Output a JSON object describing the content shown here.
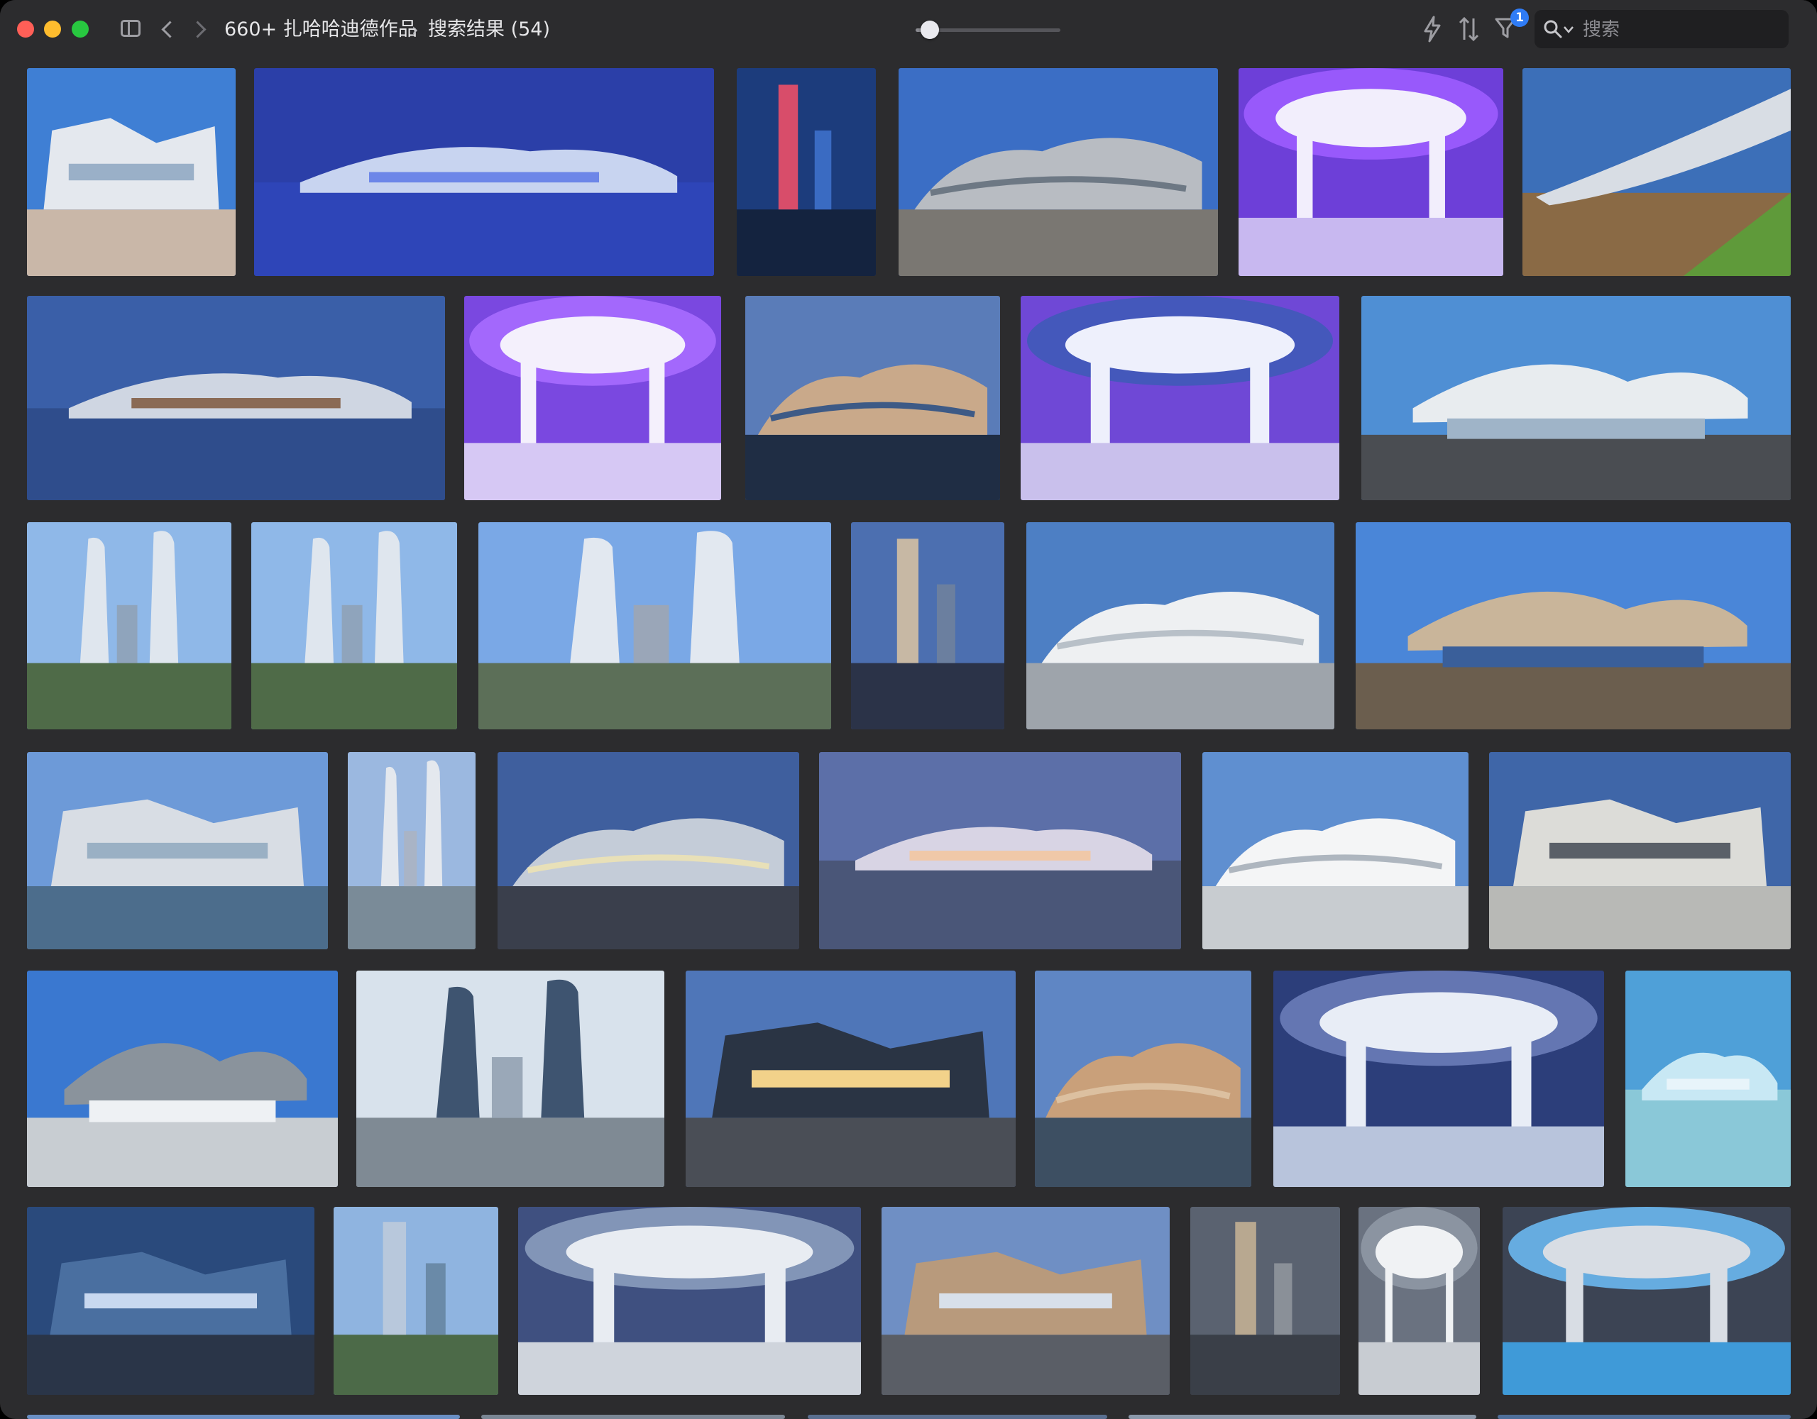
{
  "window": {
    "breadcrumb": [
      "660+ 扎哈哈迪德作品",
      "›",
      "搜索结果 (54)"
    ],
    "filter_badge": "1",
    "zoom_level": 0.1
  },
  "search": {
    "placeholder": "搜索",
    "value": ""
  },
  "colors": {
    "window_bg": "#2c2c2e",
    "accent": "#2f7cf6"
  },
  "icons": [
    "sidebar-toggle-icon",
    "back-icon",
    "forward-icon",
    "lightning-icon",
    "sort-icon",
    "filter-icon",
    "search-icon",
    "chevron-down-icon"
  ],
  "thumbnails": [
    {
      "name": "white-angular-building-day",
      "sky": "#3f7fd4",
      "ground": "#c9b7a8",
      "shape": "#e4e8ee",
      "accent": "#9ab0c8",
      "kind": "angular"
    },
    {
      "name": "night-snow-pavilion",
      "sky": "#2b3fa8",
      "ground": "#2e45b8",
      "shape": "#c8d4f0",
      "accent": "#6d86e8",
      "kind": "flat"
    },
    {
      "name": "ski-jump-tower-night",
      "sky": "#1c3c7c",
      "ground": "#14233f",
      "shape": "#d84d6a",
      "accent": "#3a6bc2",
      "kind": "tower"
    },
    {
      "name": "steel-concert-hall",
      "sky": "#3b6ec5",
      "ground": "#7a7772",
      "shape": "#b8bcc2",
      "accent": "#6d7884",
      "kind": "curvy"
    },
    {
      "name": "purple-lit-interior",
      "sky": "#6d3fd8",
      "ground": "#c8b8f0",
      "shape": "#f2eefc",
      "accent": "#9c5cff",
      "kind": "interior"
    },
    {
      "name": "bridge-pavilion-river",
      "sky": "#3c6fb8",
      "ground": "#8a6a45",
      "shape": "#d8dde4",
      "accent": "#5f9a3a",
      "kind": "bridge"
    },
    {
      "name": "science-center-dusk",
      "sky": "#3a5fa8",
      "ground": "#2f4d8c",
      "shape": "#cfd6e2",
      "accent": "#8a6a55",
      "kind": "flat"
    },
    {
      "name": "purple-gallery-columns",
      "sky": "#7a48e0",
      "ground": "#d6c8f4",
      "shape": "#f4f0fc",
      "accent": "#a76cff",
      "kind": "interior"
    },
    {
      "name": "curved-building-dusk-water",
      "sky": "#5a7cb8",
      "ground": "#1f2d44",
      "shape": "#c9a98a",
      "accent": "#3d5a86",
      "kind": "curvy"
    },
    {
      "name": "aviation-gallery-purple",
      "sky": "#6f48d6",
      "ground": "#c9c0ec",
      "shape": "#eef0fc",
      "accent": "#3f5ab8",
      "kind": "interior"
    },
    {
      "name": "white-canopy-station",
      "sky": "#4f8fd4",
      "ground": "#4a4d52",
      "shape": "#e8ecef",
      "accent": "#9fb4c8",
      "kind": "canopy"
    },
    {
      "name": "twin-towers-park-a",
      "sky": "#8fb8e8",
      "ground": "#4f6b48",
      "shape": "#dfe6ee",
      "accent": "#8fa4bc",
      "kind": "twin"
    },
    {
      "name": "twin-towers-park-b",
      "sky": "#8fb8e8",
      "ground": "#4f6b48",
      "shape": "#dfe6ee",
      "accent": "#8fa4bc",
      "kind": "twin"
    },
    {
      "name": "twin-towers-wide",
      "sky": "#7aa8e6",
      "ground": "#5c6f58",
      "shape": "#e2e8f0",
      "accent": "#9aa6b8",
      "kind": "twin"
    },
    {
      "name": "tall-tower-dusk",
      "sky": "#4c6fb0",
      "ground": "#2b3348",
      "shape": "#c7b8a4",
      "accent": "#6b7f9f",
      "kind": "tower"
    },
    {
      "name": "wave-building-blue-sky",
      "sky": "#4d7fc4",
      "ground": "#9ea4ab",
      "shape": "#eef0f2",
      "accent": "#b8c0c8",
      "kind": "curvy"
    },
    {
      "name": "aquatics-centre-waterfront",
      "sky": "#4a86d8",
      "ground": "#6b5e4e",
      "shape": "#c9b59a",
      "accent": "#3a5f9a",
      "kind": "canopy"
    },
    {
      "name": "silver-museum-river",
      "sky": "#6d9ad8",
      "ground": "#4c6d8c",
      "shape": "#d8dde4",
      "accent": "#9ab0c4",
      "kind": "angular"
    },
    {
      "name": "twin-towers-tall",
      "sky": "#9bb8e0",
      "ground": "#7a8b98",
      "shape": "#e4e8ee",
      "accent": "#a9b4c6",
      "kind": "twin"
    },
    {
      "name": "night-shopping-complex",
      "sky": "#3f5f9e",
      "ground": "#3a3f4c",
      "shape": "#c4ccd8",
      "accent": "#e8e0b8",
      "kind": "curvy"
    },
    {
      "name": "aerial-flowing-complex",
      "sky": "#5c6fa8",
      "ground": "#4a5678",
      "shape": "#d8d4e4",
      "accent": "#f0c8a8",
      "kind": "flat"
    },
    {
      "name": "white-blob-buildings",
      "sky": "#5f8fd0",
      "ground": "#c8ccd0",
      "shape": "#f4f5f6",
      "accent": "#aeb6bf",
      "kind": "curvy"
    },
    {
      "name": "maxxi-museum",
      "sky": "#3f66a8",
      "ground": "#b8b9b6",
      "shape": "#dcdcd8",
      "accent": "#5a6068",
      "kind": "angular"
    },
    {
      "name": "stadium-plaza-day",
      "sky": "#3a78d0",
      "ground": "#c8cdd2",
      "shape": "#8a939c",
      "accent": "#eef1f4",
      "kind": "canopy"
    },
    {
      "name": "glass-twin-cube-towers",
      "sky": "#d8e2ec",
      "ground": "#7f8a94",
      "shape": "#3e5470",
      "accent": "#9aa8b8",
      "kind": "twin"
    },
    {
      "name": "cantilever-library-dusk",
      "sky": "#4f76b8",
      "ground": "#4a4e56",
      "shape": "#2a3444",
      "accent": "#f2d28a",
      "kind": "angular"
    },
    {
      "name": "titanium-museum-river",
      "sky": "#5f86c4",
      "ground": "#3d4f62",
      "shape": "#c9a07a",
      "accent": "#dcc0a0",
      "kind": "curvy"
    },
    {
      "name": "white-fluid-interior",
      "sky": "#2c3e7a",
      "ground": "#b8c4dc",
      "shape": "#e8edf6",
      "accent": "#6a7cb8",
      "kind": "interior"
    },
    {
      "name": "ice-glass-facade",
      "sky": "#4fa0d8",
      "ground": "#8ac8d8",
      "shape": "#c8e8f4",
      "accent": "#e8f4fa",
      "kind": "flat"
    },
    {
      "name": "glass-void-building",
      "sky": "#2a4a7c",
      "ground": "#2a3548",
      "shape": "#4a6fa0",
      "accent": "#c8d8f0",
      "kind": "angular"
    },
    {
      "name": "glass-towers-trees",
      "sky": "#8fb4e0",
      "ground": "#4c6a48",
      "shape": "#b8c8dc",
      "accent": "#6a8aa8",
      "kind": "tower"
    },
    {
      "name": "vaulted-station-interior",
      "sky": "#3f5080",
      "ground": "#cfd4dc",
      "shape": "#e8ecf2",
      "accent": "#8a9cbc",
      "kind": "interior"
    },
    {
      "name": "port-house-antwerp",
      "sky": "#6f8fc4",
      "ground": "#5a5e66",
      "shape": "#b89a7c",
      "accent": "#d8e0ea",
      "kind": "angular"
    },
    {
      "name": "layered-towers-mist",
      "sky": "#5a6270",
      "ground": "#3a3f48",
      "shape": "#b8a890",
      "accent": "#8a9098",
      "kind": "tower"
    },
    {
      "name": "white-curved-hall",
      "sky": "#6a7280",
      "ground": "#c8ccd2",
      "shape": "#f0f2f4",
      "accent": "#8f98a4",
      "kind": "interior"
    },
    {
      "name": "aquatics-pool-interior",
      "sky": "#3c4454",
      "ground": "#3f9ad8",
      "shape": "#d8dde4",
      "accent": "#6ab8f0",
      "kind": "interior"
    }
  ]
}
